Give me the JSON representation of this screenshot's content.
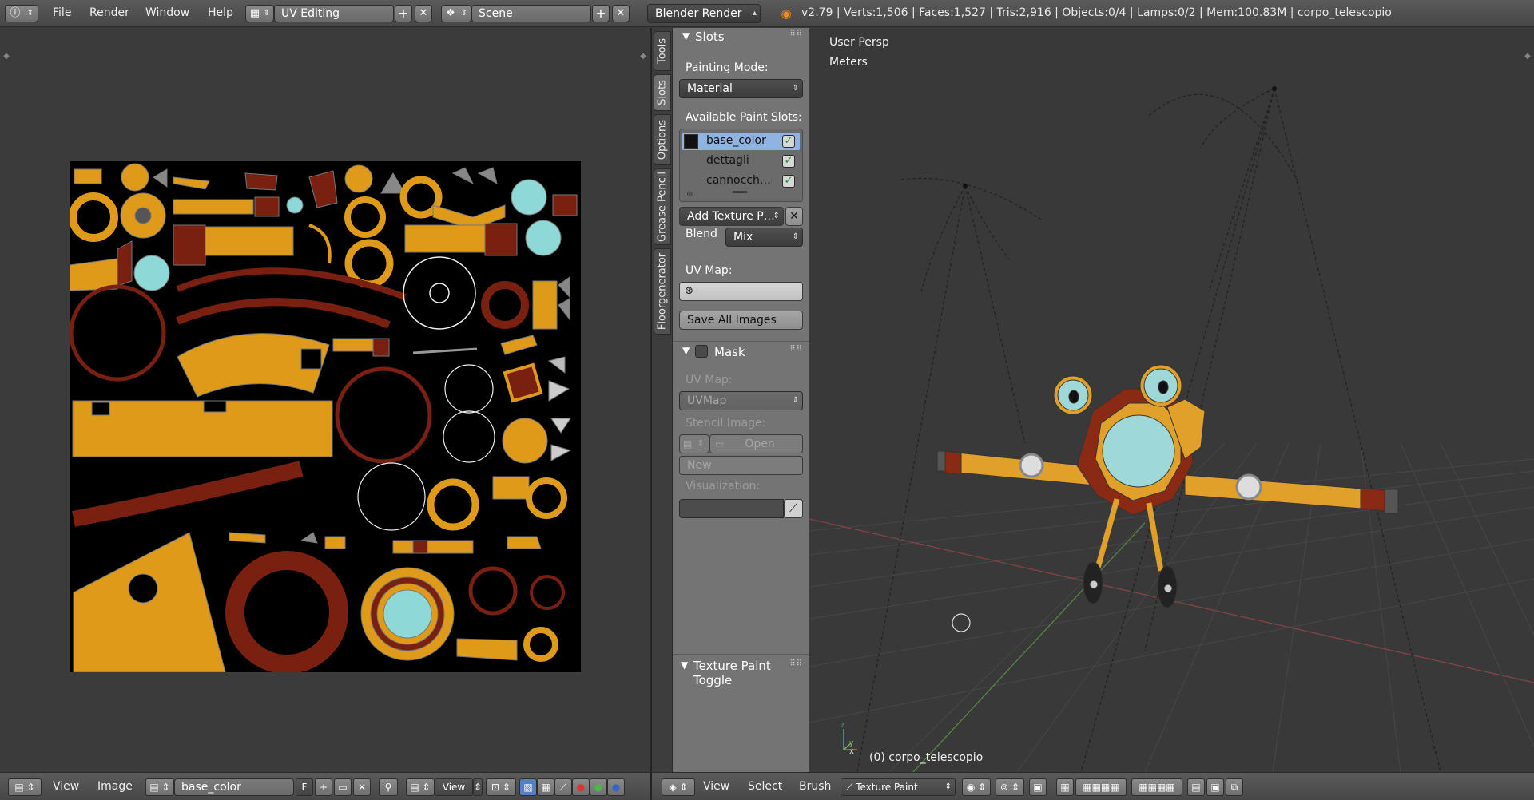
{
  "header": {
    "menus": [
      "File",
      "Render",
      "Window",
      "Help"
    ],
    "screen_layout": "UV Editing",
    "scene": "Scene",
    "render_engine": "Blender Render",
    "stats": "v2.79 | Verts:1,506 | Faces:1,527 | Tris:2,916 | Objects:0/4 | Lamps:0/2 | Mem:100.83M | corpo_telescopio"
  },
  "tool_tabs": [
    "Tools",
    "Slots",
    "Options",
    "Grease Pencil",
    "Floorgenerator"
  ],
  "slots_panel": {
    "title": "Slots",
    "painting_mode_label": "Painting Mode:",
    "painting_mode": "Material",
    "available_label": "Available Paint Slots:",
    "slots": [
      {
        "name": "base_color",
        "checked": true
      },
      {
        "name": "dettagli",
        "checked": true
      },
      {
        "name": "cannocch…",
        "checked": true
      }
    ],
    "add_texture": "Add Texture P…",
    "blend_label": "Blend",
    "blend_value": "Mix",
    "uv_map_label": "UV Map:",
    "save_all": "Save All Images"
  },
  "mask_panel": {
    "title": "Mask",
    "uv_map_label": "UV Map:",
    "uv_map_value": "UVMap",
    "stencil_label": "Stencil Image:",
    "open": "Open",
    "new": "New",
    "visualization_label": "Visualization:"
  },
  "toggle_panel": {
    "title": "Texture Paint Toggle"
  },
  "viewport": {
    "view_name": "User Persp",
    "units": "Meters",
    "object_label": "(0) corpo_telescopio"
  },
  "uv_footer": {
    "menus": [
      "View",
      "Image"
    ],
    "image_name": "base_color",
    "fake_user": "F",
    "view_mode": "View"
  },
  "viewport_footer": {
    "menus": [
      "View",
      "Select",
      "Brush"
    ],
    "mode": "Texture Paint"
  },
  "colors": {
    "accent_selected": "#8fb4e3",
    "texture_orange": "#e09a1a",
    "texture_red": "#7a2010",
    "texture_cyan": "#8fd8d8"
  }
}
